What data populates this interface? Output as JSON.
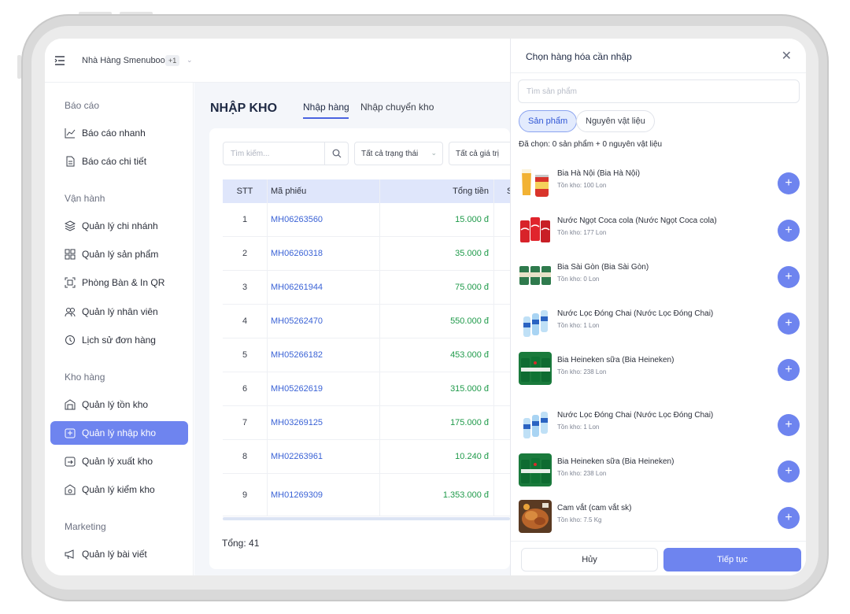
{
  "topbar": {
    "store_name": "Nhà Hàng Smenubook",
    "store_badge": "+1",
    "chevron": "⌄"
  },
  "sidebar": {
    "sections": [
      {
        "title": "Báo cáo"
      },
      {
        "title": "Vận hành"
      },
      {
        "title": "Kho hàng"
      },
      {
        "title": "Marketing"
      }
    ],
    "items": [
      {
        "label": "Báo cáo nhanh",
        "icon": "chart-line-icon"
      },
      {
        "label": "Báo cáo chi tiết",
        "icon": "document-icon"
      },
      {
        "label": "Quản lý chi nhánh",
        "icon": "layers-icon"
      },
      {
        "label": "Quản lý sản phẩm",
        "icon": "grid-icon"
      },
      {
        "label": "Phòng Bàn & In QR",
        "icon": "qr-icon"
      },
      {
        "label": "Quản lý nhân viên",
        "icon": "users-icon"
      },
      {
        "label": "Lịch sử đơn hàng",
        "icon": "history-icon"
      },
      {
        "label": "Quản lý tồn kho",
        "icon": "warehouse-icon"
      },
      {
        "label": "Quản lý nhập kho",
        "icon": "import-icon",
        "active": true
      },
      {
        "label": "Quản lý xuất kho",
        "icon": "export-icon"
      },
      {
        "label": "Quản lý kiểm kho",
        "icon": "inspect-icon"
      },
      {
        "label": "Quản lý bài viết",
        "icon": "megaphone-icon"
      }
    ]
  },
  "main": {
    "title": "NHẬP KHO",
    "tabs": [
      {
        "label": "Nhập hàng",
        "active": true
      },
      {
        "label": "Nhập chuyển kho"
      }
    ],
    "search_placeholder": "Tìm kiếm...",
    "filters": [
      "Tất cả trạng thái",
      "Tất cả giá trị"
    ],
    "columns": [
      "STT",
      "Mã phiếu",
      "Tổng tiền",
      "S"
    ],
    "rows": [
      {
        "stt": "1",
        "code": "MH06263560",
        "total": "15.000 đ"
      },
      {
        "stt": "2",
        "code": "MH06260318",
        "total": "35.000 đ"
      },
      {
        "stt": "3",
        "code": "MH06261944",
        "total": "75.000 đ"
      },
      {
        "stt": "4",
        "code": "MH05262470",
        "total": "550.000 đ"
      },
      {
        "stt": "5",
        "code": "MH05266182",
        "total": "453.000 đ"
      },
      {
        "stt": "6",
        "code": "MH05262619",
        "total": "315.000 đ"
      },
      {
        "stt": "7",
        "code": "MH03269125",
        "total": "175.000 đ"
      },
      {
        "stt": "8",
        "code": "MH02263961",
        "total": "10.240 đ"
      },
      {
        "stt": "9",
        "code": "MH01269309",
        "total": "1.353.000 đ"
      }
    ],
    "total_label": "Tổng: 41"
  },
  "panel": {
    "title": "Chọn hàng hóa cần nhập",
    "close": "✕",
    "search_placeholder": "Tìm sản phẩm",
    "chips": [
      "Sản phẩm",
      "Nguyên vật liệu"
    ],
    "selected_text": "Đã chọn: 0 sản phẩm + 0 nguyên vật liệu",
    "products": [
      {
        "name": "Bia Hà Nội (Bia Hà Nội)",
        "stock": "Tồn kho: 100 Lon",
        "image": "beer-glass"
      },
      {
        "name": "Nước Ngọt Coca cola (Nước Ngọt Coca cola)",
        "stock": "Tồn kho: 177 Lon",
        "image": "coca-cans"
      },
      {
        "name": "Bia Sài Gòn (Bia Sài Gòn)",
        "stock": "Tồn kho: 0 Lon",
        "image": "saigon-cans"
      },
      {
        "name": "Nước Lọc Đóng Chai (Nước Lọc Đóng Chai)",
        "stock": "Tồn kho: 1 Lon",
        "image": "water-bottles"
      },
      {
        "name": "Bia Heineken sữa (Bia Heineken)",
        "stock": "Tồn kho: 238 Lon",
        "image": "heineken-cans"
      },
      {
        "name": "Nước Lọc Đóng Chai (Nước Lọc Đóng Chai)",
        "stock": "Tồn kho: 1 Lon",
        "image": "water-bottles"
      },
      {
        "name": "Bia Heineken sữa (Bia Heineken)",
        "stock": "Tồn kho: 238 Lon",
        "image": "heineken-cans"
      },
      {
        "name": "Cam vắt (cam vắt sk)",
        "stock": "Tồn kho: 7.5 Kg",
        "image": "food-dish"
      }
    ],
    "add_symbol": "+",
    "cancel_label": "Hủy",
    "next_label": "Tiếp tục"
  },
  "colors": {
    "accent": "#6e84ef",
    "link": "#3b63d6",
    "money": "#1f9a4a",
    "table_header": "#dfe6fb"
  }
}
